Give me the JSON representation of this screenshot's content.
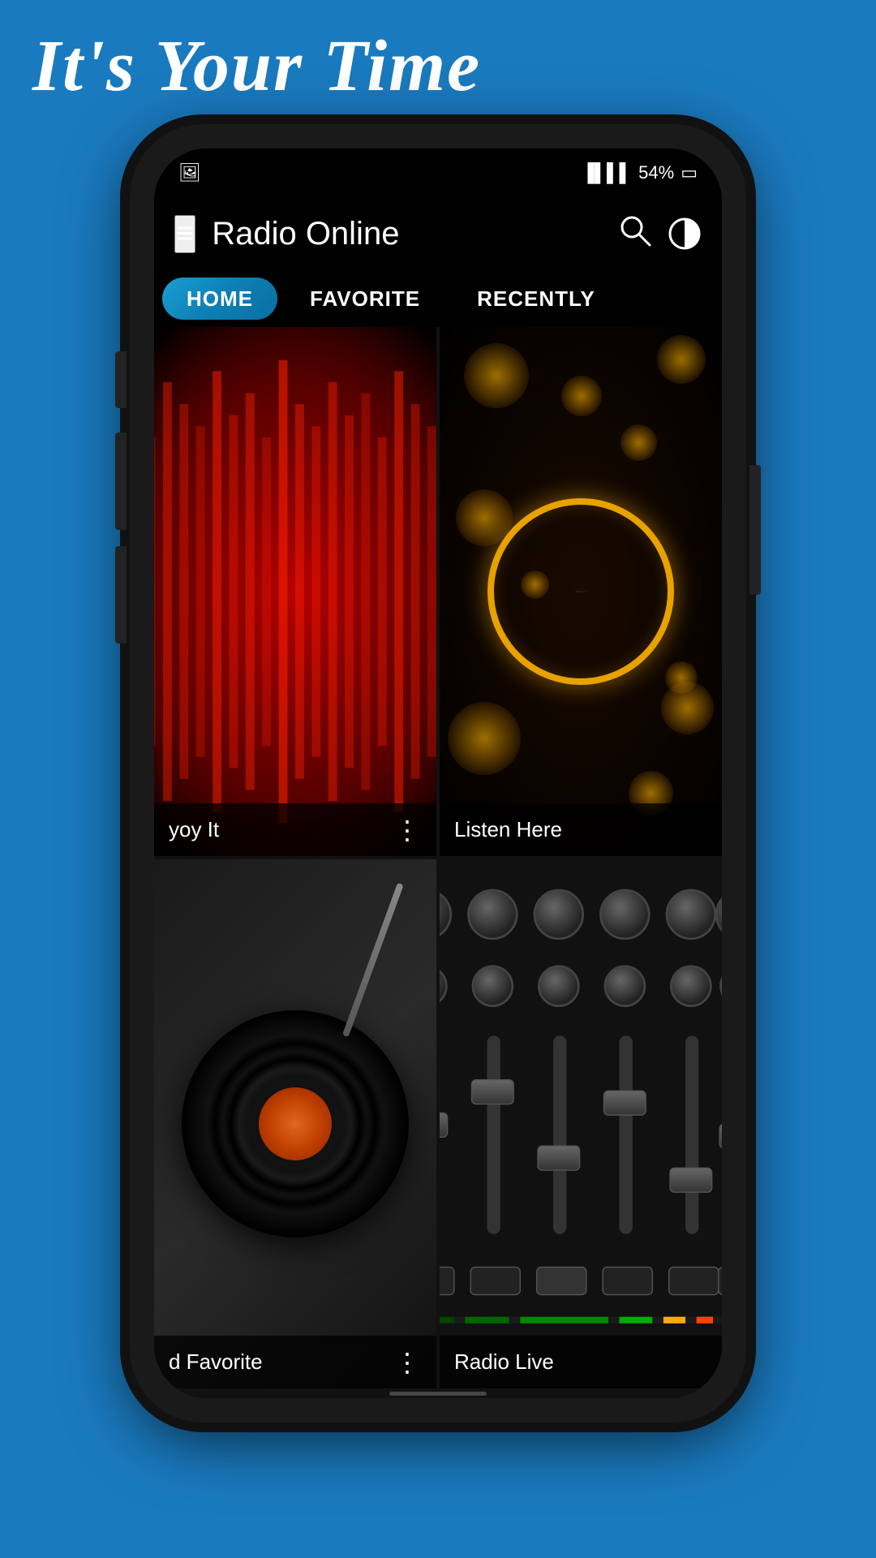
{
  "background_color": "#1a7abf",
  "header": {
    "tagline": "It's Your Time",
    "app_title": "Radio Online"
  },
  "status_bar": {
    "signal_icon": "📶",
    "battery_percent": "54%",
    "battery_icon": "🔋"
  },
  "toolbar": {
    "menu_icon": "≡",
    "search_icon": "⌕",
    "extra_icon": "◑"
  },
  "tabs": [
    {
      "id": "home",
      "label": "HOME",
      "active": true
    },
    {
      "id": "favorite",
      "label": "FAVORITE",
      "active": false
    },
    {
      "id": "recently",
      "label": "RECENTLY",
      "active": false
    }
  ],
  "cards": [
    {
      "id": "enjoy-it",
      "label": "yoy It",
      "has_dots": true,
      "type": "red-waveform"
    },
    {
      "id": "listen-here",
      "label": "Listen Here",
      "has_dots": false,
      "type": "gold-bokeh"
    },
    {
      "id": "your-favorite",
      "label": "d Favorite",
      "has_dots": true,
      "type": "vinyl"
    },
    {
      "id": "radio-live",
      "label": "Radio Live",
      "has_dots": false,
      "type": "mixer"
    }
  ]
}
